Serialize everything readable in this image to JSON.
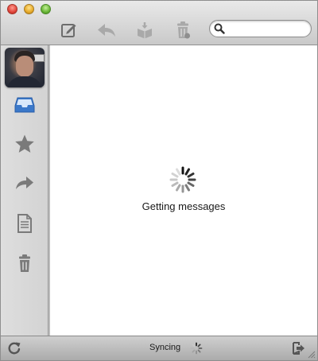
{
  "toolbar": {
    "buttons": [
      {
        "name": "compose",
        "icon": "compose-icon"
      },
      {
        "name": "reply",
        "icon": "reply-icon"
      },
      {
        "name": "archive",
        "icon": "archive-box-icon"
      },
      {
        "name": "delete",
        "icon": "trash-icon"
      }
    ],
    "search": {
      "value": "",
      "placeholder": ""
    }
  },
  "sidebar": {
    "avatar": {
      "icon": "user-photo"
    },
    "items": [
      {
        "name": "inbox",
        "icon": "inbox-tray-icon",
        "selected": true
      },
      {
        "name": "starred",
        "icon": "star-icon",
        "selected": false
      },
      {
        "name": "sent",
        "icon": "forward-arrow-icon",
        "selected": false
      },
      {
        "name": "drafts",
        "icon": "document-icon",
        "selected": false
      },
      {
        "name": "trash",
        "icon": "trash-icon",
        "selected": false
      }
    ]
  },
  "main": {
    "status_text": "Getting messages"
  },
  "bottombar": {
    "sync_text": "Syncing",
    "left_icon": "refresh-icon",
    "right_icon": "sign-out-icon"
  },
  "colors": {
    "accent_selected": "#3b78c9",
    "icon_gray": "#7a7a7a",
    "icon_disabled": "#a9a9a9"
  }
}
